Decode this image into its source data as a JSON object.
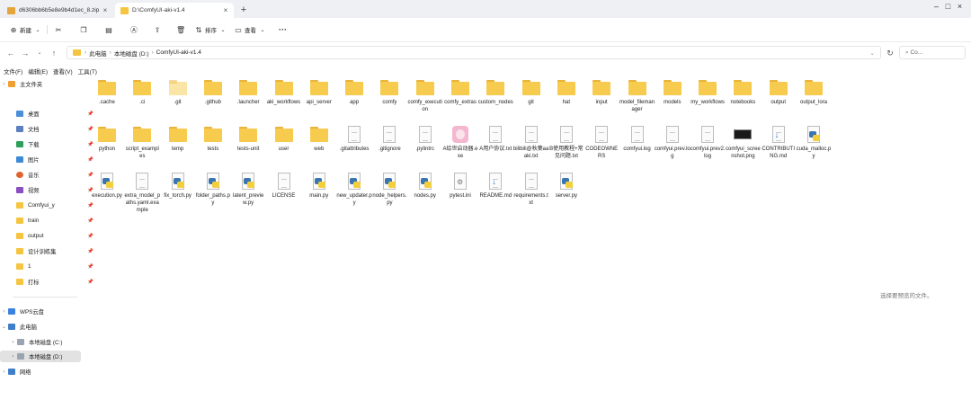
{
  "tabs": [
    {
      "label": "d6306bb6b5e8e9b4d1ec_8.zip",
      "active": false
    },
    {
      "label": "D:\\ComfyUI-aki-v1.4",
      "active": true
    }
  ],
  "toolbar": {
    "new_label": "新建",
    "sort_label": "排序",
    "view_label": "查看",
    "more_label": "···"
  },
  "address": {
    "crumbs": [
      "此电脑",
      "本地磁盘 (D:)",
      "ComfyUI-aki-v1.4"
    ],
    "search_placeholder": "Co..."
  },
  "menu": [
    "文件(F)",
    "编辑(E)",
    "查看(V)",
    "工具(T)"
  ],
  "sidebar": {
    "home": "主文件夹",
    "quick": [
      "桌面",
      "文档",
      "下载",
      "图片",
      "音乐",
      "视频",
      "Comfyui_y",
      "train",
      "output",
      "设计训练集",
      "1",
      "打标"
    ],
    "wps": "WPS云盘",
    "pc": "此电脑",
    "drives": [
      "本地磁盘 (C:)",
      "本地磁盘 (D:)"
    ],
    "network": "网络"
  },
  "files": [
    {
      "name": ".cache",
      "type": "folder"
    },
    {
      "name": ".ci",
      "type": "folder"
    },
    {
      "name": ".git",
      "type": "folder-config"
    },
    {
      "name": ".github",
      "type": "folder"
    },
    {
      "name": ".launcher",
      "type": "folder"
    },
    {
      "name": "aki_workflows",
      "type": "folder"
    },
    {
      "name": "api_server",
      "type": "folder"
    },
    {
      "name": "app",
      "type": "folder"
    },
    {
      "name": "comfy",
      "type": "folder"
    },
    {
      "name": "comfy_execution",
      "type": "folder"
    },
    {
      "name": "comfy_extras",
      "type": "folder"
    },
    {
      "name": "custom_nodes",
      "type": "folder"
    },
    {
      "name": "git",
      "type": "folder"
    },
    {
      "name": "hat",
      "type": "folder"
    },
    {
      "name": "input",
      "type": "folder"
    },
    {
      "name": "model_filemanager",
      "type": "folder"
    },
    {
      "name": "models",
      "type": "folder"
    },
    {
      "name": "my_workflows",
      "type": "folder"
    },
    {
      "name": "notebooks",
      "type": "folder"
    },
    {
      "name": "output",
      "type": "folder"
    },
    {
      "name": "output_lora",
      "type": "folder"
    },
    {
      "name": "python",
      "type": "folder"
    },
    {
      "name": "script_examples",
      "type": "folder"
    },
    {
      "name": "temp",
      "type": "folder"
    },
    {
      "name": "tests",
      "type": "folder"
    },
    {
      "name": "tests-unit",
      "type": "folder"
    },
    {
      "name": "user",
      "type": "folder"
    },
    {
      "name": "web",
      "type": "folder"
    },
    {
      "name": ".gitattributes",
      "type": "doc"
    },
    {
      "name": ".gitignore",
      "type": "doc"
    },
    {
      "name": ".pylintrc",
      "type": "doc"
    },
    {
      "name": "A绘世启动器.exe",
      "type": "exe"
    },
    {
      "name": "A用户协议.txt",
      "type": "doc"
    },
    {
      "name": "bilibili@秋葉aaaki.txt",
      "type": "doc"
    },
    {
      "name": "B使用教程+常见问题.txt",
      "type": "doc"
    },
    {
      "name": "CODEOWNERS",
      "type": "doc"
    },
    {
      "name": "comfyui.log",
      "type": "doc"
    },
    {
      "name": "comfyui.prev.log",
      "type": "doc"
    },
    {
      "name": "comfyui.prev2.log",
      "type": "doc"
    },
    {
      "name": "comfyui_screenshot.png",
      "type": "png"
    },
    {
      "name": "CONTRIBUTING.md",
      "type": "md"
    },
    {
      "name": "cuda_malloc.py",
      "type": "py"
    },
    {
      "name": "execution.py",
      "type": "py"
    },
    {
      "name": "extra_model_paths.yaml.example",
      "type": "doc"
    },
    {
      "name": "fix_torch.py",
      "type": "py"
    },
    {
      "name": "folder_paths.py",
      "type": "py"
    },
    {
      "name": "latent_preview.py",
      "type": "py"
    },
    {
      "name": "LICENSE",
      "type": "doc"
    },
    {
      "name": "main.py",
      "type": "py"
    },
    {
      "name": "new_updater.py",
      "type": "py"
    },
    {
      "name": "node_helpers.py",
      "type": "py"
    },
    {
      "name": "nodes.py",
      "type": "py"
    },
    {
      "name": "pytest.ini",
      "type": "ini"
    },
    {
      "name": "README.md",
      "type": "md"
    },
    {
      "name": "requirements.txt",
      "type": "doc"
    },
    {
      "name": "server.py",
      "type": "py"
    }
  ],
  "status_text": "选择要预览的文件。",
  "colors": {
    "folder": "#f7cb4d",
    "python_blue": "#3b75b0",
    "python_yellow": "#f2cf3b",
    "selected": "#e2e2e2"
  }
}
